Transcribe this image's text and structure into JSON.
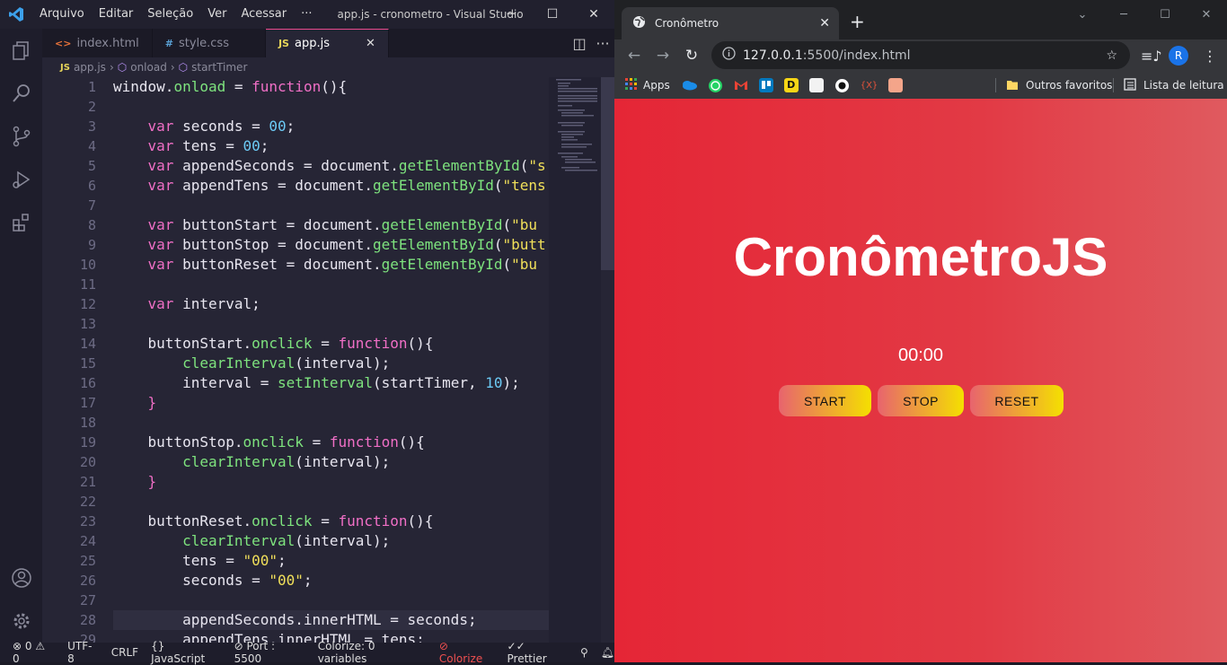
{
  "vscode": {
    "menu": [
      "Arquivo",
      "Editar",
      "Seleção",
      "Ver",
      "Acessar",
      "···"
    ],
    "window_title": "app.js - cronometro - Visual Studio ...",
    "tabs": [
      {
        "icon": "<>",
        "label": "index.html"
      },
      {
        "icon": "#",
        "label": "style.css"
      },
      {
        "icon": "JS",
        "label": "app.js"
      }
    ],
    "breadcrumb": {
      "file": "app.js",
      "sym1": "onload",
      "sym2": "startTimer"
    },
    "lines": [
      [
        [
          "p",
          "window."
        ],
        [
          "f",
          "onload"
        ],
        [
          "p",
          " = "
        ],
        [
          "k",
          "function"
        ],
        [
          "p",
          "(){"
        ]
      ],
      [],
      [
        [
          "p",
          "    "
        ],
        [
          "k",
          "var"
        ],
        [
          "p",
          " seconds = "
        ],
        [
          "n",
          "00"
        ],
        [
          "p",
          ";"
        ]
      ],
      [
        [
          "p",
          "    "
        ],
        [
          "k",
          "var"
        ],
        [
          "p",
          " tens = "
        ],
        [
          "n",
          "00"
        ],
        [
          "p",
          ";"
        ]
      ],
      [
        [
          "p",
          "    "
        ],
        [
          "k",
          "var"
        ],
        [
          "p",
          " appendSeconds = document."
        ],
        [
          "f",
          "getElementById"
        ],
        [
          "p",
          "("
        ],
        [
          "s",
          "\"s"
        ]
      ],
      [
        [
          "p",
          "    "
        ],
        [
          "k",
          "var"
        ],
        [
          "p",
          " appendTens = document."
        ],
        [
          "f",
          "getElementById"
        ],
        [
          "p",
          "("
        ],
        [
          "s",
          "\"tens"
        ]
      ],
      [],
      [
        [
          "p",
          "    "
        ],
        [
          "k",
          "var"
        ],
        [
          "p",
          " buttonStart = document."
        ],
        [
          "f",
          "getElementById"
        ],
        [
          "p",
          "("
        ],
        [
          "s",
          "\"bu"
        ]
      ],
      [
        [
          "p",
          "    "
        ],
        [
          "k",
          "var"
        ],
        [
          "p",
          " buttonStop = document."
        ],
        [
          "f",
          "getElementById"
        ],
        [
          "p",
          "("
        ],
        [
          "s",
          "\"butt"
        ]
      ],
      [
        [
          "p",
          "    "
        ],
        [
          "k",
          "var"
        ],
        [
          "p",
          " buttonReset = document."
        ],
        [
          "f",
          "getElementById"
        ],
        [
          "p",
          "("
        ],
        [
          "s",
          "\"bu"
        ]
      ],
      [],
      [
        [
          "p",
          "    "
        ],
        [
          "k",
          "var"
        ],
        [
          "p",
          " interval;"
        ]
      ],
      [],
      [
        [
          "p",
          "    buttonStart."
        ],
        [
          "f",
          "onclick"
        ],
        [
          "p",
          " = "
        ],
        [
          "k",
          "function"
        ],
        [
          "p",
          "(){"
        ]
      ],
      [
        [
          "p",
          "        "
        ],
        [
          "f",
          "clearInterval"
        ],
        [
          "p",
          "(interval);"
        ]
      ],
      [
        [
          "p",
          "        interval = "
        ],
        [
          "f",
          "setInterval"
        ],
        [
          "p",
          "(startTimer, "
        ],
        [
          "n",
          "10"
        ],
        [
          "p",
          ");"
        ]
      ],
      [
        [
          "p",
          "    "
        ],
        [
          "k",
          "}"
        ]
      ],
      [],
      [
        [
          "p",
          "    buttonStop."
        ],
        [
          "f",
          "onclick"
        ],
        [
          "p",
          " = "
        ],
        [
          "k",
          "function"
        ],
        [
          "p",
          "(){"
        ]
      ],
      [
        [
          "p",
          "        "
        ],
        [
          "f",
          "clearInterval"
        ],
        [
          "p",
          "(interval);"
        ]
      ],
      [
        [
          "p",
          "    "
        ],
        [
          "k",
          "}"
        ]
      ],
      [],
      [
        [
          "p",
          "    buttonReset."
        ],
        [
          "f",
          "onclick"
        ],
        [
          "p",
          " = "
        ],
        [
          "k",
          "function"
        ],
        [
          "p",
          "(){"
        ]
      ],
      [
        [
          "p",
          "        "
        ],
        [
          "f",
          "clearInterval"
        ],
        [
          "p",
          "(interval);"
        ]
      ],
      [
        [
          "p",
          "        tens = "
        ],
        [
          "s",
          "\"00\""
        ],
        [
          "p",
          ";"
        ]
      ],
      [
        [
          "p",
          "        seconds = "
        ],
        [
          "s",
          "\"00\""
        ],
        [
          "p",
          ";"
        ]
      ],
      [],
      [
        [
          "p",
          "        appendSeconds.innerHTML = seconds;"
        ]
      ],
      [
        [
          "p",
          "        appendTens.innerHTML = tens;"
        ]
      ]
    ],
    "line_numbers": [
      "1",
      "2",
      "3",
      "4",
      "5",
      "6",
      "7",
      "8",
      "9",
      "10",
      "11",
      "12",
      "13",
      "14",
      "15",
      "16",
      "17",
      "18",
      "19",
      "20",
      "21",
      "22",
      "23",
      "24",
      "25",
      "26",
      "27",
      "28",
      "29"
    ],
    "status": {
      "problems": "0",
      "warnings": "0",
      "encoding": "UTF-8",
      "eol": "CRLF",
      "language": "JavaScript",
      "port": "Port : 5500",
      "colorize": "Colorize: 0 variables",
      "colorize2": "Colorize",
      "prettier": "Prettier"
    }
  },
  "chrome": {
    "tab_title": "Cronômetro",
    "url_host": "127.0.0.1",
    "url_rest": ":5500/index.html",
    "bookmarks": {
      "apps": "Apps",
      "favorites": "Outros favoritos",
      "reading": "Lista de leitura"
    },
    "profile_initial": "R"
  },
  "page": {
    "heading": "CronômetroJS",
    "time": "00:00",
    "buttons": [
      "START",
      "STOP",
      "RESET"
    ]
  }
}
